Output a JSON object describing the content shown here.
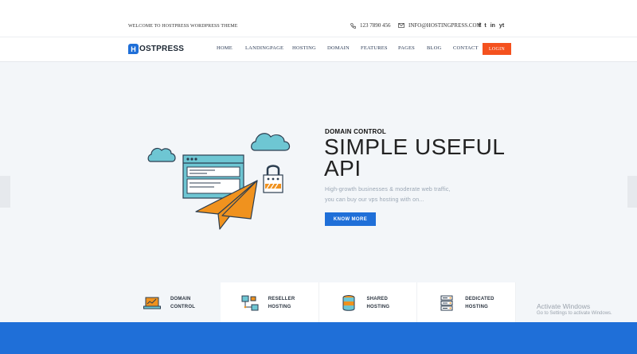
{
  "topbar": {
    "welcome": "WELCOME TO HOSTPRESS WORDPRESS THEME",
    "phone": "123 7890 456",
    "email": "INFO@HOSTINGPRESS.COM",
    "socials": [
      "f",
      "t",
      "in",
      "yt"
    ]
  },
  "brand": {
    "logo_letter": "H",
    "logo_text": "OSTPRESS"
  },
  "nav": {
    "items": [
      "HOME",
      "LANDINGPAGE",
      "HOSTING",
      "DOMAIN",
      "FEATURES",
      "PAGES",
      "BLOG",
      "CONTACT"
    ],
    "login": "LOGIN"
  },
  "hero": {
    "eyebrow": "DOMAIN CONTROL",
    "headline_line1": "SIMPLE USEFUL",
    "headline_line2": "API",
    "desc_line1": "High-growth businesses & moderate web traffic,",
    "desc_line2": "you can buy our vps hosting with on...",
    "button": "KNOW MORE"
  },
  "features": [
    {
      "line1": "DOMAIN",
      "line2": "CONTROL",
      "icon": "laptop-chart-icon"
    },
    {
      "line1": "RESELLER",
      "line2": "HOSTING",
      "icon": "network-icon"
    },
    {
      "line1": "SHARED",
      "line2": "HOSTING",
      "icon": "database-icon"
    },
    {
      "line1": "DEDICATED",
      "line2": "HOSTING",
      "icon": "server-icon"
    }
  ],
  "watermark": {
    "title": "Activate Windows",
    "subtitle": "Go to Settings to activate Windows."
  },
  "colors": {
    "primary": "#1f6fd8",
    "accent": "#f4511e",
    "orange": "#f0921e",
    "teal": "#6ec6d3"
  }
}
